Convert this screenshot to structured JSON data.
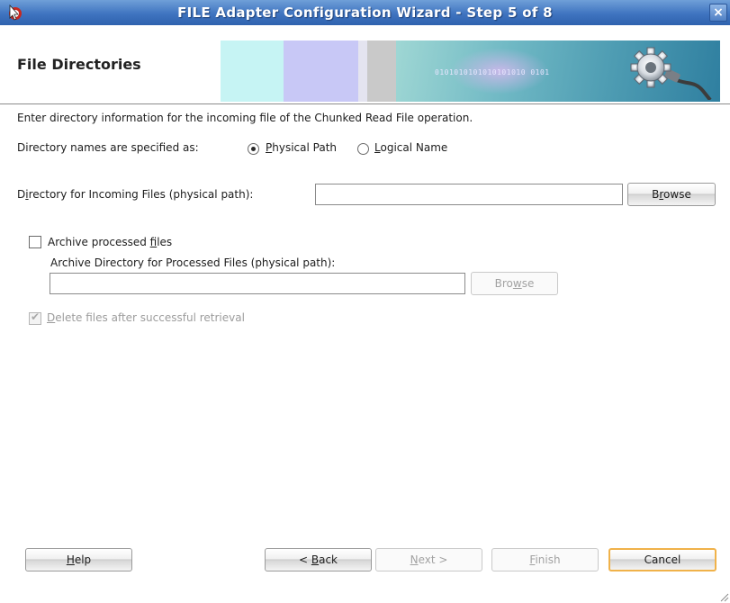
{
  "window": {
    "title": "FILE Adapter Configuration Wizard - Step 5 of 8",
    "close_glyph": "×"
  },
  "header": {
    "title": "File Directories",
    "banner_text": "0101010101010101010 0101"
  },
  "content": {
    "instructions": "Enter directory information for the incoming file of the Chunked Read File operation.",
    "directory_names_label": "Directory names are specified as:",
    "radio_physical": {
      "mnemonic": "P",
      "rest": "hysical Path",
      "selected": true
    },
    "radio_logical": {
      "mnemonic": "L",
      "rest": "ogical Name",
      "selected": false
    },
    "incoming_dir_label": {
      "pre": "D",
      "mnemonic": "i",
      "post": "rectory for Incoming Files (physical path):"
    },
    "incoming_dir_value": "",
    "browse_incoming": {
      "pre": "B",
      "mnemonic": "r",
      "post": "owse"
    },
    "archive_checkbox": {
      "pre": "Archive processed ",
      "mnemonic": "f",
      "post": "iles",
      "checked": false
    },
    "archive_dir_label": "Archive Directory for Processed Files (physical path):",
    "archive_dir_value": "",
    "browse_archive": {
      "pre": "Bro",
      "mnemonic": "w",
      "post": "se",
      "disabled": true
    },
    "delete_checkbox": {
      "mnemonic": "D",
      "rest": "elete files after successful retrieval",
      "checked": true,
      "disabled": true
    }
  },
  "footer": {
    "help": {
      "mnemonic": "H",
      "rest": "elp"
    },
    "back": {
      "pre": "< ",
      "mnemonic": "B",
      "post": "ack"
    },
    "next": {
      "mnemonic": "N",
      "rest": "ext >",
      "disabled": true
    },
    "finish": {
      "mnemonic": "F",
      "rest": "inish",
      "disabled": true
    },
    "cancel": "Cancel"
  },
  "colors": {
    "titlebar": "#3f74c0",
    "default_button_border": "#f0b24a"
  }
}
